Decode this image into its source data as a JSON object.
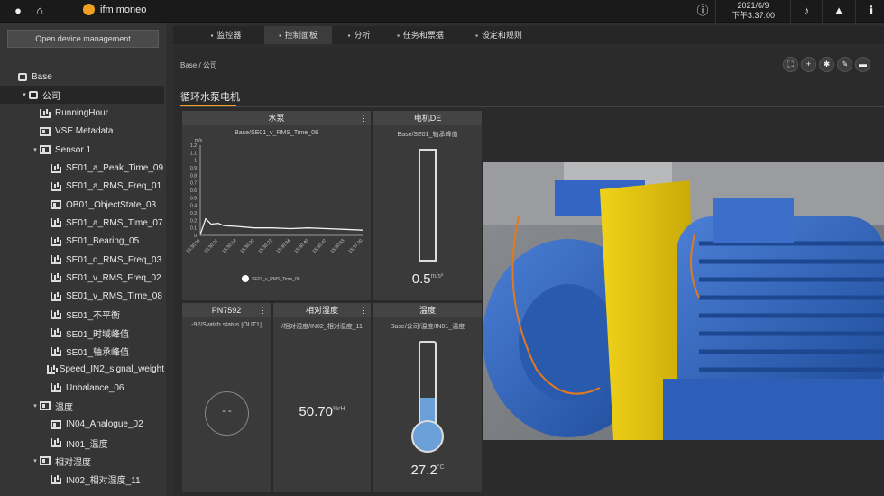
{
  "topbar": {
    "brand": "ifm moneo",
    "date": "2021/6/9",
    "time": "下午3:37:00"
  },
  "sidebar": {
    "open_button": "Open device management",
    "items": [
      {
        "label": "Base",
        "icon": "node-icon",
        "level": 0,
        "arrow": ""
      },
      {
        "label": "公司",
        "icon": "node-icon",
        "level": 1,
        "arrow": "▾"
      },
      {
        "label": "RunningHour",
        "icon": "chart-icon",
        "level": 2,
        "arrow": ""
      },
      {
        "label": "VSE Metadata",
        "icon": "device-icon",
        "level": 2,
        "arrow": ""
      },
      {
        "label": "Sensor 1",
        "icon": "device-icon",
        "level": 2,
        "arrow": "▾"
      },
      {
        "label": "SE01_a_Peak_Time_09",
        "icon": "chart-icon",
        "level": 3,
        "arrow": ""
      },
      {
        "label": "SE01_a_RMS_Freq_01",
        "icon": "chart-icon",
        "level": 3,
        "arrow": ""
      },
      {
        "label": "OB01_ObjectState_03",
        "icon": "state-icon",
        "level": 3,
        "arrow": ""
      },
      {
        "label": "SE01_a_RMS_Time_07",
        "icon": "chart-icon",
        "level": 3,
        "arrow": ""
      },
      {
        "label": "SE01_Bearing_05",
        "icon": "chart-icon",
        "level": 3,
        "arrow": ""
      },
      {
        "label": "SE01_d_RMS_Freq_03",
        "icon": "chart-icon",
        "level": 3,
        "arrow": ""
      },
      {
        "label": "SE01_v_RMS_Freq_02",
        "icon": "chart-icon",
        "level": 3,
        "arrow": ""
      },
      {
        "label": "SE01_v_RMS_Time_08",
        "icon": "chart-icon",
        "level": 3,
        "arrow": ""
      },
      {
        "label": "SE01_不平衡",
        "icon": "chart-icon",
        "level": 3,
        "arrow": ""
      },
      {
        "label": "SE01_时域峰值",
        "icon": "chart-icon",
        "level": 3,
        "arrow": ""
      },
      {
        "label": "SE01_轴承峰值",
        "icon": "chart-icon",
        "level": 3,
        "arrow": ""
      },
      {
        "label": "Speed_IN2_signal_weight",
        "icon": "chart-icon",
        "level": 3,
        "arrow": ""
      },
      {
        "label": "Unbalance_06",
        "icon": "chart-icon",
        "level": 3,
        "arrow": ""
      },
      {
        "label": "温度",
        "icon": "device-icon",
        "level": 2,
        "arrow": "▾"
      },
      {
        "label": "IN04_Analogue_02",
        "icon": "state-icon",
        "level": 3,
        "arrow": ""
      },
      {
        "label": "IN01_温度",
        "icon": "chart-icon",
        "level": 3,
        "arrow": ""
      },
      {
        "label": "相对湿度",
        "icon": "device-icon",
        "level": 2,
        "arrow": "▾"
      },
      {
        "label": "IN02_相对湿度_11",
        "icon": "chart-icon",
        "level": 3,
        "arrow": ""
      }
    ]
  },
  "tabs": [
    {
      "label": "监控器",
      "icon": "monitor-icon",
      "active": false
    },
    {
      "label": "控制面板",
      "icon": "dashboard-icon",
      "active": true
    },
    {
      "label": "分析",
      "icon": "analysis-icon",
      "active": false
    },
    {
      "label": "任务和票据",
      "icon": "tasks-icon",
      "active": false
    },
    {
      "label": "设定和规则",
      "icon": "settings-icon",
      "active": false
    }
  ],
  "breadcrumb": "Base / 公司",
  "dashboard_title": "循环水泵电机",
  "widgets": {
    "pump": {
      "title": "水泵",
      "subtitle": "Base/SE01_v_RMS_Time_08",
      "unit": "m/s",
      "legend": "SE01_v_RMS_Time_08"
    },
    "motor": {
      "title": "电机DE",
      "subtitle": "Base/SE01_轴承峰值",
      "value": "0.5",
      "unit": "m/s²",
      "level": 0.0
    },
    "pn": {
      "title": "PN7592",
      "subtitle": "-92/Switch status [OUT1]",
      "value": "- -"
    },
    "humidity": {
      "title": "相对湿度",
      "subtitle": "/相对湿度/IN02_相对湿度_11",
      "value": "50.70",
      "unit": "%rH"
    },
    "temp": {
      "title": "温度",
      "subtitle": "Base/公司/温度/IN01_温度",
      "value": "27.2",
      "unit": "°C",
      "level": 0.38
    }
  },
  "chart_data": {
    "type": "line",
    "title": "Base/SE01_v_RMS_Time_08",
    "ylabel": "m/s",
    "ylim": [
      0,
      1.2
    ],
    "yticks": [
      "1.2",
      "1.1",
      "1",
      "0.9",
      "0.8",
      "0.7",
      "0.6",
      "0.5",
      "0.4",
      "0.3",
      "0.2",
      "0.1",
      "0"
    ],
    "xticks": [
      "15:30:00",
      "15:30:07",
      "15:30:14",
      "15:30:20",
      "15:30:27",
      "15:30:34",
      "15:30:40",
      "15:30:47",
      "15:30:53",
      "15:37:00"
    ],
    "series": [
      {
        "name": "SE01_v_RMS_Time_08",
        "x": [
          0,
          0.3,
          0.6,
          1,
          1.3,
          2,
          3,
          4,
          5,
          6,
          7,
          8,
          9
        ],
        "y": [
          0.01,
          0.22,
          0.15,
          0.16,
          0.13,
          0.12,
          0.1,
          0.1,
          0.09,
          0.1,
          0.09,
          0.08,
          0.07
        ]
      }
    ]
  }
}
